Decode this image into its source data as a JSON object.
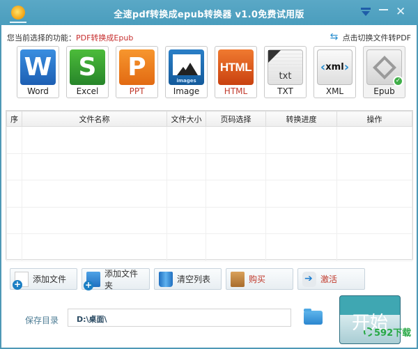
{
  "window": {
    "title": "全速pdf转换成epub转换器 v1.0免费试用版",
    "controls": [
      "menu",
      "minimize",
      "close"
    ]
  },
  "function_bar": {
    "label": "您当前选择的功能：",
    "value": "PDF转换成Epub",
    "switch_link": "点击切换文件转PDF"
  },
  "formats": [
    {
      "id": "word",
      "label": "Word",
      "glyph": "W",
      "color": "#1d5fb3"
    },
    {
      "id": "excel",
      "label": "Excel",
      "glyph": "S",
      "color": "#27852a"
    },
    {
      "id": "ppt",
      "label": "PPT",
      "glyph": "P",
      "color": "#e26a12"
    },
    {
      "id": "image",
      "label": "Image",
      "glyph": "images",
      "color": "#135a9b"
    },
    {
      "id": "html",
      "label": "HTML",
      "glyph": "HTML",
      "color": "#c9410f"
    },
    {
      "id": "txt",
      "label": "TXT",
      "glyph": "txt",
      "color": "#dcdcdc"
    },
    {
      "id": "xml",
      "label": "XML",
      "glyph": "xml",
      "color": "#2a8fd0"
    },
    {
      "id": "epub",
      "label": "Epub",
      "glyph": "epub",
      "color": "#9a9a9a",
      "selected": true
    }
  ],
  "table": {
    "columns": [
      "序",
      "文件名称",
      "文件大小",
      "页码选择",
      "转换进度",
      "操作"
    ],
    "rows": []
  },
  "actions": {
    "add_file": "添加文件",
    "add_folder": "添加文件夹",
    "clear_list": "清空列表",
    "buy": "购买",
    "activate": "激活"
  },
  "save": {
    "label": "保存目录",
    "path": "D:\\桌面\\",
    "start": "开始"
  },
  "watermark": {
    "text": "592下载"
  },
  "colors": {
    "titlebar": "#4a9dbd",
    "accent_red": "#c62d2d",
    "start_button": "#3fa7b2"
  }
}
